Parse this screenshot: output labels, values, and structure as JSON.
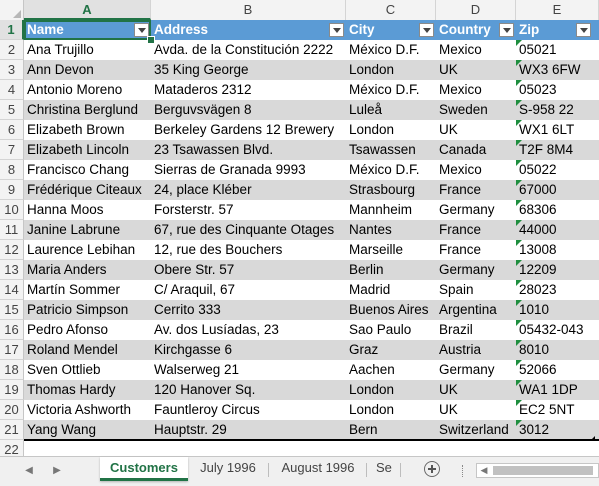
{
  "columns": [
    "A",
    "B",
    "C",
    "D",
    "E"
  ],
  "row_numbers": [
    "1",
    "2",
    "3",
    "4",
    "5",
    "6",
    "7",
    "8",
    "9",
    "10",
    "11",
    "12",
    "13",
    "14",
    "15",
    "16",
    "17",
    "18",
    "19",
    "20",
    "21",
    "22"
  ],
  "table": {
    "headers": [
      "Name",
      "Address",
      "City",
      "Country",
      "Zip"
    ],
    "rows": [
      [
        "Ana Trujillo",
        "Avda. de la Constitución 2222",
        "México D.F.",
        "Mexico",
        "05021"
      ],
      [
        "Ann Devon",
        "35 King George",
        "London",
        "UK",
        "WX3 6FW"
      ],
      [
        "Antonio Moreno",
        "Mataderos  2312",
        "México D.F.",
        "Mexico",
        "05023"
      ],
      [
        "Christina Berglund",
        "Berguvsvägen  8",
        "Luleå",
        "Sweden",
        "S-958 22"
      ],
      [
        "Elizabeth Brown",
        "Berkeley Gardens 12  Brewery",
        "London",
        "UK",
        "WX1 6LT"
      ],
      [
        "Elizabeth Lincoln",
        "23 Tsawassen Blvd.",
        "Tsawassen",
        "Canada",
        "T2F 8M4"
      ],
      [
        "Francisco Chang",
        "Sierras de Granada 9993",
        "México D.F.",
        "Mexico",
        "05022"
      ],
      [
        "Frédérique Citeaux",
        "24, place Kléber",
        "Strasbourg",
        "France",
        "67000"
      ],
      [
        "Hanna Moos",
        "Forsterstr. 57",
        "Mannheim",
        "Germany",
        "68306"
      ],
      [
        "Janine Labrune",
        "67, rue des Cinquante Otages",
        "Nantes",
        "France",
        "44000"
      ],
      [
        "Laurence Lebihan",
        "12, rue des Bouchers",
        "Marseille",
        "France",
        "13008"
      ],
      [
        "Maria Anders",
        "Obere Str. 57",
        "Berlin",
        "Germany",
        "12209"
      ],
      [
        "Martín Sommer",
        "C/ Araquil, 67",
        "Madrid",
        "Spain",
        "28023"
      ],
      [
        "Patricio Simpson",
        "Cerrito 333",
        "Buenos Aires",
        "Argentina",
        "1010"
      ],
      [
        "Pedro Afonso",
        "Av. dos Lusíadas, 23",
        "Sao Paulo",
        "Brazil",
        "05432-043"
      ],
      [
        "Roland Mendel",
        "Kirchgasse 6",
        "Graz",
        "Austria",
        "8010"
      ],
      [
        "Sven Ottlieb",
        "Walserweg 21",
        "Aachen",
        "Germany",
        "52066"
      ],
      [
        "Thomas Hardy",
        "120 Hanover Sq.",
        "London",
        "UK",
        "WA1 1DP"
      ],
      [
        "Victoria Ashworth",
        "Fauntleroy Circus",
        "London",
        "UK",
        "EC2 5NT"
      ],
      [
        "Yang Wang",
        "Hauptstr. 29",
        "Bern",
        "Switzerland",
        "3012"
      ]
    ]
  },
  "sheet_tabs": [
    "Customers",
    "July 1996",
    "August 1996",
    "Se"
  ],
  "active_sheet": "Customers",
  "colors": {
    "header_fill": "#5b9bd5",
    "band_fill": "#d9d9d9",
    "excel_green": "#217346"
  }
}
